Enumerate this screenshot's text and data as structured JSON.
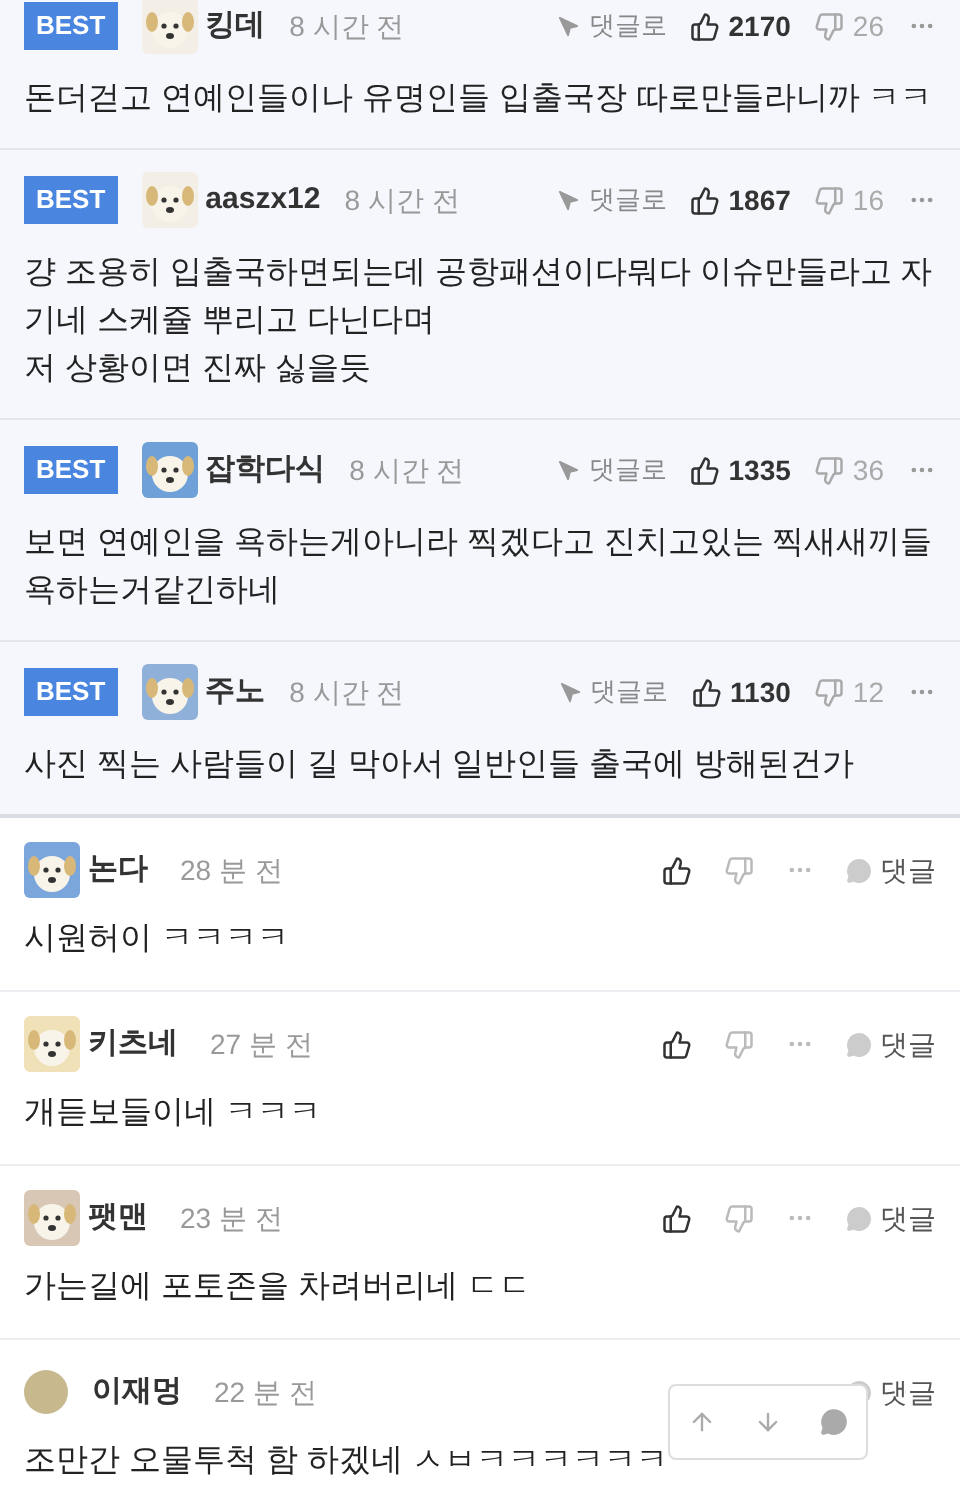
{
  "best_comments": [
    {
      "badge": "BEST",
      "author": "킹데",
      "time": "8 시간 전",
      "reply_link": "댓글로",
      "likes": "2170",
      "dislikes": "26",
      "text": "돈더걷고 연예인들이나 유명인들 입출국장 따로만들라니까 ㅋㅋ"
    },
    {
      "badge": "BEST",
      "author": "aaszx12",
      "time": "8 시간 전",
      "reply_link": "댓글로",
      "likes": "1867",
      "dislikes": "16",
      "text": "걍 조용히 입출국하면되는데 공항패션이다뭐다 이슈만들라고 자기네 스케쥴 뿌리고 다닌다며\n저 상황이면 진짜 싫을듯"
    },
    {
      "badge": "BEST",
      "author": "잡학다식",
      "time": "8 시간 전",
      "reply_link": "댓글로",
      "likes": "1335",
      "dislikes": "36",
      "text": "보면 연예인을 욕하는게아니라 찍겠다고 진치고있는 찍새새끼들 욕하는거같긴하네"
    },
    {
      "badge": "BEST",
      "author": "주노",
      "time": "8 시간 전",
      "reply_link": "댓글로",
      "likes": "1130",
      "dislikes": "12",
      "text": "사진 찍는 사람들이 길 막아서 일반인들 출국에 방해된건가"
    }
  ],
  "comments": [
    {
      "author": "논다",
      "time": "28 분 전",
      "reply": "댓글",
      "text": "시원허이 ㅋㅋㅋㅋ",
      "actions_hidden": false
    },
    {
      "author": "키츠네",
      "time": "27 분 전",
      "reply": "댓글",
      "text": "개듣보들이네 ㅋㅋㅋ",
      "actions_hidden": false
    },
    {
      "author": "팻맨",
      "time": "23 분 전",
      "reply": "댓글",
      "text": "가는길에 포토존을 차려버리네 ㄷㄷ",
      "actions_hidden": false
    },
    {
      "author": "이재멍",
      "time": "22 분 전",
      "reply": "댓글",
      "text": "조만간 오물투척 함 하겠네 ㅅㅂㅋㅋㅋㅋㅋㅋ",
      "actions_hidden": true
    }
  ]
}
